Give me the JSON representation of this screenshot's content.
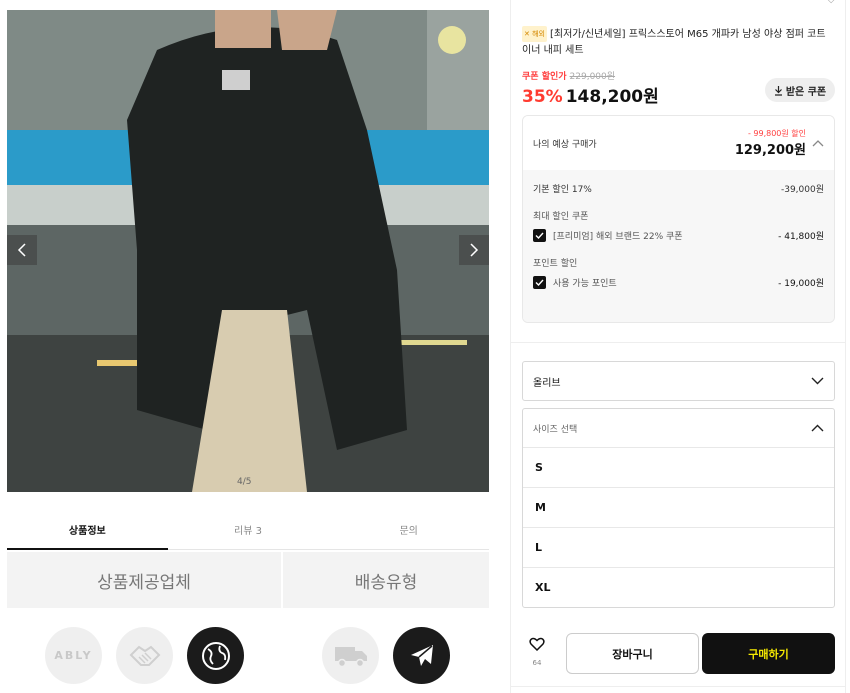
{
  "gallery": {
    "counter": "4/5"
  },
  "tabs": [
    {
      "label": "상품정보"
    },
    {
      "label": "리뷰 3"
    },
    {
      "label": "문의"
    }
  ],
  "info": {
    "provider_title": "상품제공업체",
    "shipping_title": "배송유형",
    "ably_text": "ABLY"
  },
  "product": {
    "promo_chip": "✕ 해외",
    "title": "[최저가/신년세일] 프릭스스토어 M65 개파카 남성 야상 점퍼 코트 이너 내피 세트",
    "coupon_label": "쿠폰 할인가",
    "original_price": "229,000원",
    "discount_rate": "35%",
    "sale_price": "148,200원",
    "coupon_button": "받은 쿠폰"
  },
  "estimate": {
    "label": "나의 예상 구매가",
    "discount_total": "- 99,800원 할인",
    "final_price": "129,200원",
    "base_discount_label": "기본 할인 17%",
    "base_discount_value": "-39,000원",
    "coupon_section": "최대 할인 쿠폰",
    "coupon_item": "[프리미엄] 해외 브랜드 22% 쿠폰",
    "coupon_value": "- 41,800원",
    "point_section": "포인트 할인",
    "point_item": "사용 가능 포인트",
    "point_value": "- 19,000원"
  },
  "options": {
    "color_selected": "올리브",
    "size_placeholder": "사이즈 선택",
    "sizes": [
      "S",
      "M",
      "L",
      "XL"
    ]
  },
  "actions": {
    "like_count": "64",
    "cart": "장바구니",
    "buy": "구매하기"
  },
  "colors": {
    "accent_red": "#ff3b30",
    "buy_bg": "#111111",
    "buy_text": "#f5e900"
  }
}
